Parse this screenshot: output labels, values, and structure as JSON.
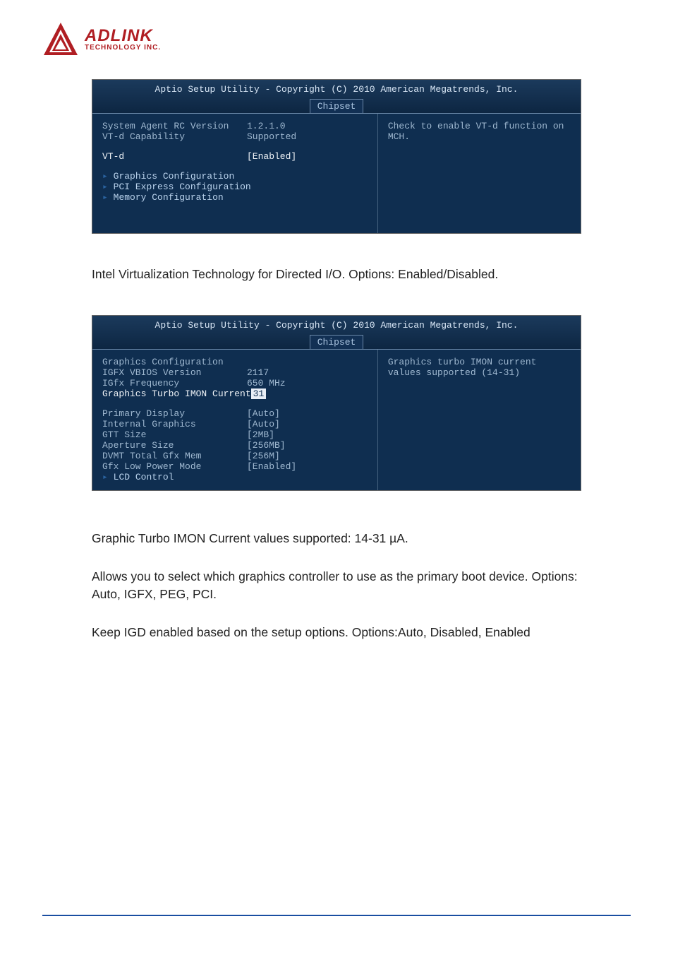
{
  "logo": {
    "brand": "ADLINK",
    "sub": "TECHNOLOGY INC."
  },
  "bios1": {
    "title": "Aptio Setup Utility - Copyright (C) 2010 American Megatrends, Inc.",
    "tab": "Chipset",
    "rows": {
      "r1_label": "System Agent RC Version",
      "r1_value": "1.2.1.0",
      "r2_label": "VT-d Capability",
      "r2_value": "Supported",
      "r3_label": "VT-d",
      "r3_value": "[Enabled]"
    },
    "submenus": {
      "m1": "Graphics Configuration",
      "m2": "PCI Express Configuration",
      "m3": "Memory Configuration"
    },
    "help": "Check to enable VT-d function on MCH."
  },
  "para1": "Intel Virtualization Technology for Directed I/O. Options: Enabled/Disabled.",
  "bios2": {
    "title": "Aptio Setup Utility - Copyright (C) 2010 American Megatrends, Inc.",
    "tab": "Chipset",
    "header": "Graphics Configuration",
    "rows": {
      "r1_label": "IGFX VBIOS Version",
      "r1_value": "2117",
      "r2_label": "IGfx Frequency",
      "r2_value": "650 MHz",
      "r3_label": "Graphics Turbo IMON Current",
      "r3_value": "31",
      "r4_label": "Primary Display",
      "r4_value": "[Auto]",
      "r5_label": "Internal Graphics",
      "r5_value": "[Auto]",
      "r6_label": "GTT Size",
      "r6_value": "[2MB]",
      "r7_label": "Aperture Size",
      "r7_value": "[256MB]",
      "r8_label": "DVMT Total Gfx Mem",
      "r8_value": "[256M]",
      "r9_label": "Gfx Low Power Mode",
      "r9_value": "[Enabled]"
    },
    "submenu": "LCD Control",
    "help": "Graphics turbo IMON current values supported (14-31)"
  },
  "para2": "Graphic Turbo IMON Current values supported: 14-31 µA.",
  "para3": "Allows you to select which graphics controller to use as the primary boot device. Options: Auto, IGFX, PEG, PCI.",
  "para4": "Keep IGD enabled based on the setup options. Options:Auto, Disabled, Enabled"
}
